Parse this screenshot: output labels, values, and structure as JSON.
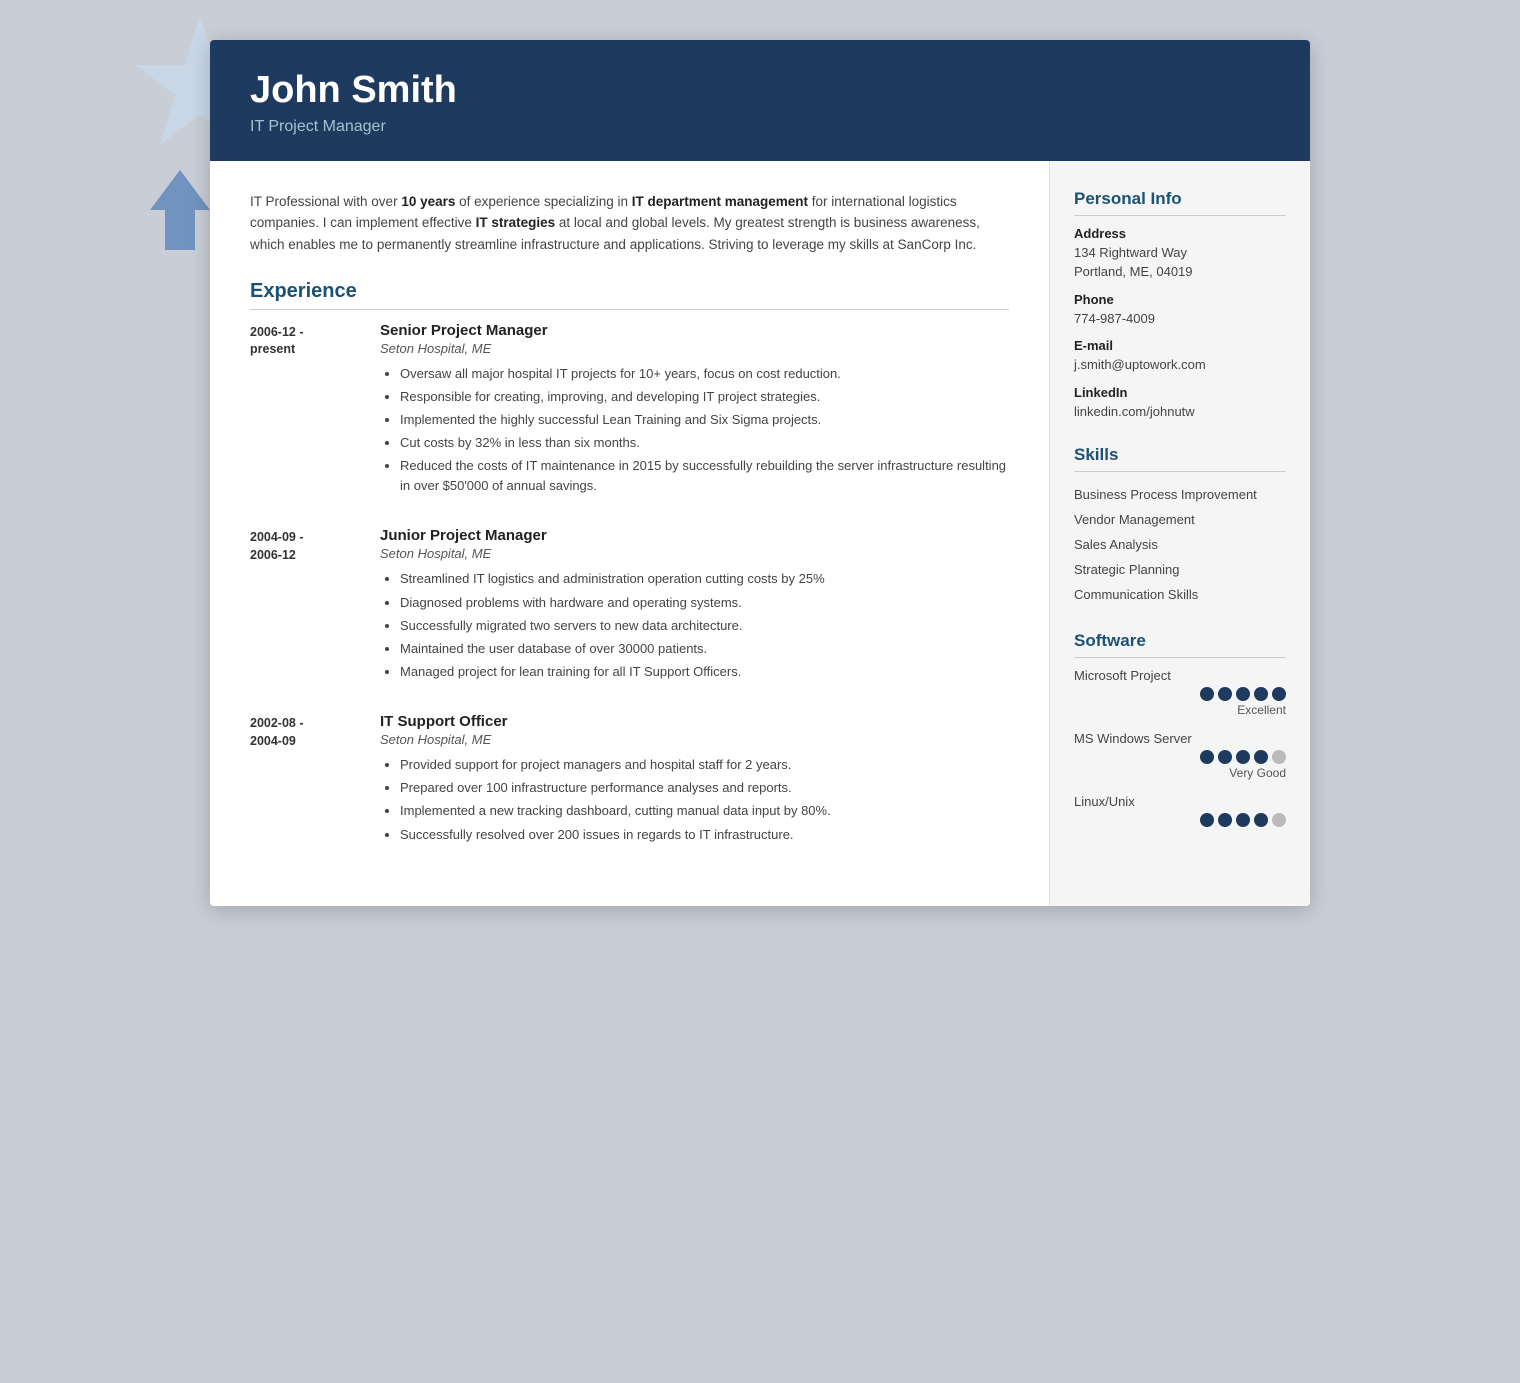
{
  "header": {
    "name": "John Smith",
    "title": "IT Project Manager"
  },
  "summary": {
    "text_parts": [
      {
        "text": "IT Professional with over ",
        "bold": false
      },
      {
        "text": "10 years",
        "bold": true
      },
      {
        "text": " of experience specializing in ",
        "bold": false
      },
      {
        "text": "IT department management",
        "bold": true
      },
      {
        "text": " for international logistics companies. I can implement effective ",
        "bold": false
      },
      {
        "text": "IT strategies",
        "bold": true
      },
      {
        "text": " at local and global levels. My greatest strength is business awareness, which enables me to permanently streamline infrastructure and applications. Striving to leverage my skills at SanCorp Inc.",
        "bold": false
      }
    ]
  },
  "experience": {
    "section_title": "Experience",
    "items": [
      {
        "date_start": "2006-12 -",
        "date_end": "present",
        "job_title": "Senior Project Manager",
        "company": "Seton Hospital, ME",
        "bullets": [
          "Oversaw all major hospital IT projects for 10+ years, focus on cost reduction.",
          "Responsible for creating, improving, and developing IT project strategies.",
          "Implemented the highly successful Lean Training and Six Sigma projects.",
          "Cut costs by 32% in less than six months.",
          "Reduced the costs of IT maintenance in 2015 by successfully rebuilding the server infrastructure resulting in over $50'000 of annual savings."
        ]
      },
      {
        "date_start": "2004-09 -",
        "date_end": "2006-12",
        "job_title": "Junior Project Manager",
        "company": "Seton Hospital, ME",
        "bullets": [
          "Streamlined IT logistics and administration operation cutting costs by 25%",
          "Diagnosed problems with hardware and operating systems.",
          "Successfully migrated two servers to new data architecture.",
          "Maintained the user database of over 30000 patients.",
          "Managed project for lean training for all IT Support Officers."
        ]
      },
      {
        "date_start": "2002-08 -",
        "date_end": "2004-09",
        "job_title": "IT Support Officer",
        "company": "Seton Hospital, ME",
        "bullets": [
          "Provided support for project managers and hospital staff for 2 years.",
          "Prepared over 100 infrastructure performance analyses and reports.",
          "Implemented a new tracking dashboard, cutting manual data input by 80%.",
          "Successfully resolved over 200 issues in regards to IT infrastructure."
        ]
      }
    ]
  },
  "personal_info": {
    "section_title": "Personal Info",
    "address_label": "Address",
    "address_line1": "134 Rightward Way",
    "address_line2": "Portland, ME, 04019",
    "phone_label": "Phone",
    "phone": "774-987-4009",
    "email_label": "E-mail",
    "email": "j.smith@uptowork.com",
    "linkedin_label": "LinkedIn",
    "linkedin": "linkedin.com/johnutw"
  },
  "skills": {
    "section_title": "Skills",
    "items": [
      "Business Process Improvement",
      "Vendor Management",
      "Sales Analysis",
      "Strategic Planning",
      "Communication Skills"
    ]
  },
  "software": {
    "section_title": "Software",
    "items": [
      {
        "name": "Microsoft Project",
        "filled": 5,
        "total": 5,
        "label": "Excellent"
      },
      {
        "name": "MS Windows Server",
        "filled": 4,
        "total": 5,
        "label": "Very Good"
      },
      {
        "name": "Linux/Unix",
        "filled": 4,
        "total": 5,
        "label": ""
      }
    ]
  },
  "colors": {
    "accent": "#1a5276",
    "header_bg": "#1e3a5f",
    "dot_filled": "#1e3a5f",
    "dot_empty": "#bbb"
  }
}
